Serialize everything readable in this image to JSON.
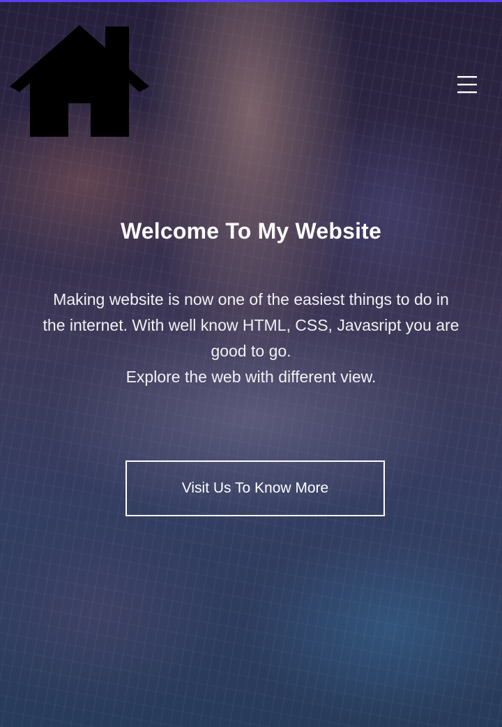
{
  "header": {
    "logo_icon": "home-icon",
    "menu_icon": "hamburger-menu-icon"
  },
  "hero": {
    "title": "Welcome To My Website",
    "paragraph_lines": [
      "Making website is now one of the easiest things to do in",
      "the internet. With well know HTML, CSS, Javasript you are",
      "good to go.",
      "Explore the web with different view."
    ],
    "cta_label": "Visit Us To Know More"
  },
  "colors": {
    "accent_bar": "#5b3df5",
    "text": "#ffffff",
    "logo": "#000000"
  }
}
